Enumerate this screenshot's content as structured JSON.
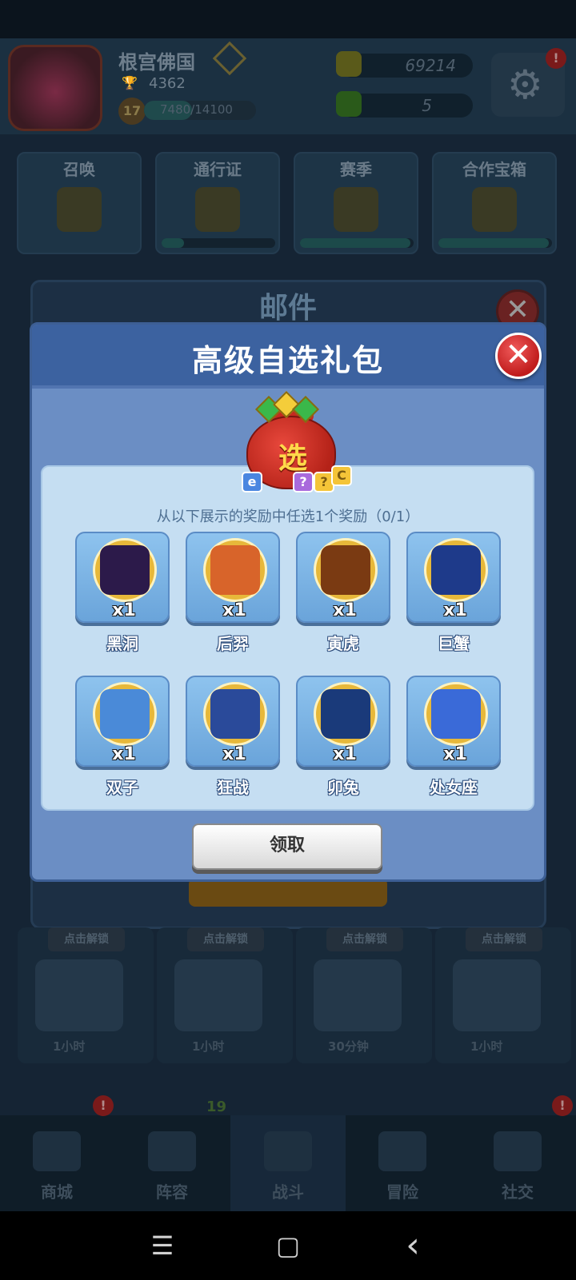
{
  "profile": {
    "name": "根宫佛国",
    "trophies": "4362",
    "level": "17",
    "xp": "7480/14100"
  },
  "currency": {
    "gold": "69214",
    "gems": "5"
  },
  "badges": {
    "settings": "!",
    "shop": "!",
    "lineup": "19",
    "social": "!"
  },
  "features": [
    {
      "label": "召唤",
      "progress": 0
    },
    {
      "label": "通行证",
      "progress": 0.12
    },
    {
      "label": "赛季",
      "progress": 0.95
    },
    {
      "label": "合作宝箱",
      "progress": 0.95
    }
  ],
  "mail": {
    "title": "邮件"
  },
  "chests": [
    {
      "label": "点击解锁",
      "time": "1小时"
    },
    {
      "label": "点击解锁",
      "time": "1小时"
    },
    {
      "label": "点击解锁",
      "time": "30分钟"
    },
    {
      "label": "点击解锁",
      "time": "1小时"
    }
  ],
  "tabs": [
    {
      "label": "商城"
    },
    {
      "label": "阵容"
    },
    {
      "label": "战斗"
    },
    {
      "label": "冒险"
    },
    {
      "label": "社交"
    }
  ],
  "modal": {
    "title": "高级自选礼包",
    "bag_char": "选",
    "subtitle": "从以下展示的奖励中任选1个奖励（0/1）",
    "claim": "领取",
    "items": [
      {
        "name": "黑洞",
        "qty": "x1",
        "icon": "galaxy-icon",
        "color": "#2c1a4a"
      },
      {
        "name": "后羿",
        "qty": "x1",
        "icon": "archer-icon",
        "color": "#d8642a"
      },
      {
        "name": "寅虎",
        "qty": "x1",
        "icon": "tiger-icon",
        "color": "#7a3a12"
      },
      {
        "name": "巨蟹",
        "qty": "x1",
        "icon": "crab-icon",
        "color": "#1e3a8a"
      },
      {
        "name": "双子",
        "qty": "x1",
        "icon": "gemini-icon",
        "color": "#4a8ad8"
      },
      {
        "name": "狂战",
        "qty": "x1",
        "icon": "berserker-icon",
        "color": "#2a4a9a"
      },
      {
        "name": "卯兔",
        "qty": "x1",
        "icon": "rabbit-icon",
        "color": "#1a3a7a"
      },
      {
        "name": "处女座",
        "qty": "x1",
        "icon": "virgo-icon",
        "color": "#3a6ad8"
      }
    ]
  },
  "nav": {
    "menu": "☰",
    "home": "▢",
    "back": "‹"
  }
}
